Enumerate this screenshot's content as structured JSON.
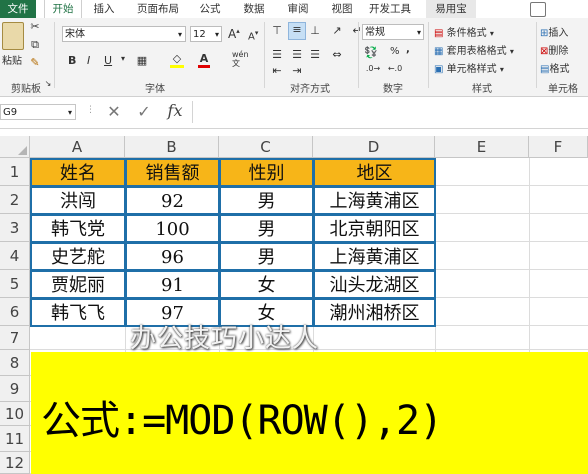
{
  "tabs": [
    {
      "label": "文件",
      "state": "file"
    },
    {
      "label": "开始",
      "state": "active"
    },
    {
      "label": "插入"
    },
    {
      "label": "页面布局"
    },
    {
      "label": "公式"
    },
    {
      "label": "数据"
    },
    {
      "label": "审阅"
    },
    {
      "label": "视图"
    },
    {
      "label": "开发工具"
    },
    {
      "label": "易用宝"
    }
  ],
  "clipboard": {
    "paste": "粘贴",
    "label": "剪贴板"
  },
  "font": {
    "name": "宋体",
    "size": "12",
    "bold": "B",
    "italic": "I",
    "underline": "U",
    "grow": "A",
    "shrink": "A",
    "label": "字体",
    "pinyin": "wén"
  },
  "alignment": {
    "label": "对齐方式"
  },
  "number": {
    "format": "常规",
    "percent": "%",
    "comma": ",",
    "label": "数字"
  },
  "styles": {
    "conditional": "条件格式",
    "table": "套用表格格式",
    "cell": "单元格样式",
    "label": "样式"
  },
  "cells": {
    "insert": "插入",
    "delete": "删除",
    "format": "格式",
    "label": "单元格"
  },
  "formula_bar": {
    "name_box": "G9",
    "cancel": "✕",
    "confirm": "✓",
    "fx": "fx",
    "content": ""
  },
  "columns": [
    "A",
    "B",
    "C",
    "D",
    "E",
    "F"
  ],
  "rows": [
    "1",
    "2",
    "3",
    "4",
    "5",
    "6",
    "7",
    "8",
    "9",
    "10",
    "11",
    "12"
  ],
  "table": {
    "headers": [
      "姓名",
      "销售额",
      "性别",
      "地区"
    ],
    "rows": [
      [
        "洪闯",
        "92",
        "男",
        "上海黄浦区"
      ],
      [
        "韩飞党",
        "100",
        "男",
        "北京朝阳区"
      ],
      [
        "史艺舵",
        "96",
        "男",
        "上海黄浦区"
      ],
      [
        "贾妮丽",
        "91",
        "女",
        "汕头龙湖区"
      ],
      [
        "韩飞飞",
        "97",
        "女",
        "潮州湘桥区"
      ]
    ]
  },
  "watermark": "办公技巧小达人",
  "banner": {
    "text": "公式:=MOD(ROW(),2)"
  },
  "colors": {
    "header_fill": "#f7b518",
    "border": "#1f6fa8",
    "banner": "#ffff00",
    "excel_green": "#217346"
  }
}
